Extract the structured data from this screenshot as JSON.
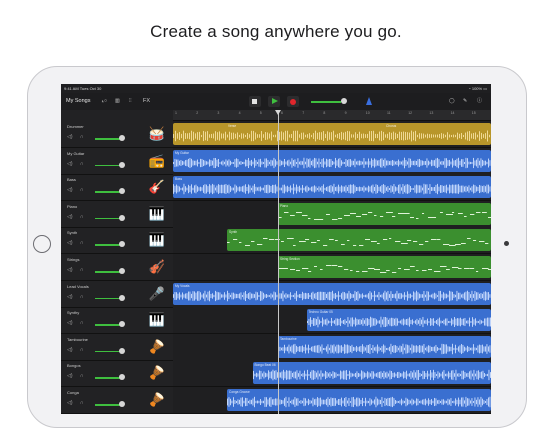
{
  "headline": "Create a song anywhere you go.",
  "status": {
    "time": "9:41 AM  Tues Oct 30",
    "battery": "100%"
  },
  "toolbar": {
    "title": "My Songs",
    "fx_label": "FX",
    "icons": [
      "tracks-view-icon",
      "keyboard-icon",
      "mixer-icon",
      "fx-icon",
      "stop-icon",
      "play-icon",
      "record-icon",
      "master-volume-slider",
      "metronome-icon",
      "loop-icon",
      "settings-wrench-icon",
      "help-icon"
    ]
  },
  "colors": {
    "drummer": "#b8962a",
    "audio_blue": "#3a6fd0",
    "midi_green": "#3b8f2f",
    "bg": "#1f1f21"
  },
  "ruler": [
    "1",
    "2",
    "3",
    "4",
    "5",
    "6",
    "7",
    "8",
    "9",
    "10",
    "11",
    "12",
    "13",
    "14",
    "15"
  ],
  "tracks": [
    {
      "name": "Drummer",
      "instrument_icon": "drum-kit-icon",
      "glyph": "🥁",
      "regions": [
        {
          "label": "",
          "start": 0,
          "end": 1,
          "kind": "drummer"
        }
      ],
      "sub_labels": [
        "Verse",
        "Chorus"
      ]
    },
    {
      "name": "My Guitar",
      "instrument_icon": "guitar-amp-icon",
      "glyph": "📻",
      "regions": [
        {
          "label": "My Guitar",
          "start": 0,
          "end": 1,
          "kind": "audio"
        }
      ]
    },
    {
      "name": "Bass",
      "instrument_icon": "bass-guitar-icon",
      "glyph": "🎸",
      "regions": [
        {
          "label": "Bass",
          "start": 0,
          "end": 1,
          "kind": "audio"
        }
      ]
    },
    {
      "name": "Piano",
      "instrument_icon": "piano-icon",
      "glyph": "🎹",
      "regions": [
        {
          "label": "Piano",
          "start": 0.33,
          "end": 1,
          "kind": "midi"
        }
      ]
    },
    {
      "name": "Synth",
      "instrument_icon": "synth-keyboard-icon",
      "glyph": "🎹",
      "regions": [
        {
          "label": "Synth",
          "start": 0.17,
          "end": 1,
          "kind": "midi"
        }
      ]
    },
    {
      "name": "Strings",
      "instrument_icon": "violin-icon",
      "glyph": "🎻",
      "regions": [
        {
          "label": "String Section",
          "start": 0.33,
          "end": 1,
          "kind": "midi"
        }
      ]
    },
    {
      "name": "Lead Vocals",
      "instrument_icon": "microphone-icon",
      "glyph": "🎤",
      "regions": [
        {
          "label": "My Vocals",
          "start": 0,
          "end": 1,
          "kind": "audio"
        }
      ]
    },
    {
      "name": "Synthy",
      "instrument_icon": "synth-keyboard-icon",
      "glyph": "🎹",
      "regions": [
        {
          "label": "Techno Guitar 05",
          "start": 0.42,
          "end": 1,
          "kind": "audio"
        }
      ]
    },
    {
      "name": "Tambourine",
      "instrument_icon": "tambourine-icon",
      "glyph": "🪘",
      "regions": [
        {
          "label": "Tambourine",
          "start": 0.33,
          "end": 1,
          "kind": "audio"
        }
      ]
    },
    {
      "name": "Bongos",
      "instrument_icon": "bongo-drums-icon",
      "glyph": "🪘",
      "regions": [
        {
          "label": "Bongo Beat 06",
          "start": 0.25,
          "end": 1,
          "kind": "audio"
        }
      ]
    },
    {
      "name": "Conga",
      "instrument_icon": "conga-drums-icon",
      "glyph": "🪘",
      "regions": [
        {
          "label": "Conga Groove",
          "start": 0.17,
          "end": 1,
          "kind": "audio"
        }
      ]
    }
  ]
}
